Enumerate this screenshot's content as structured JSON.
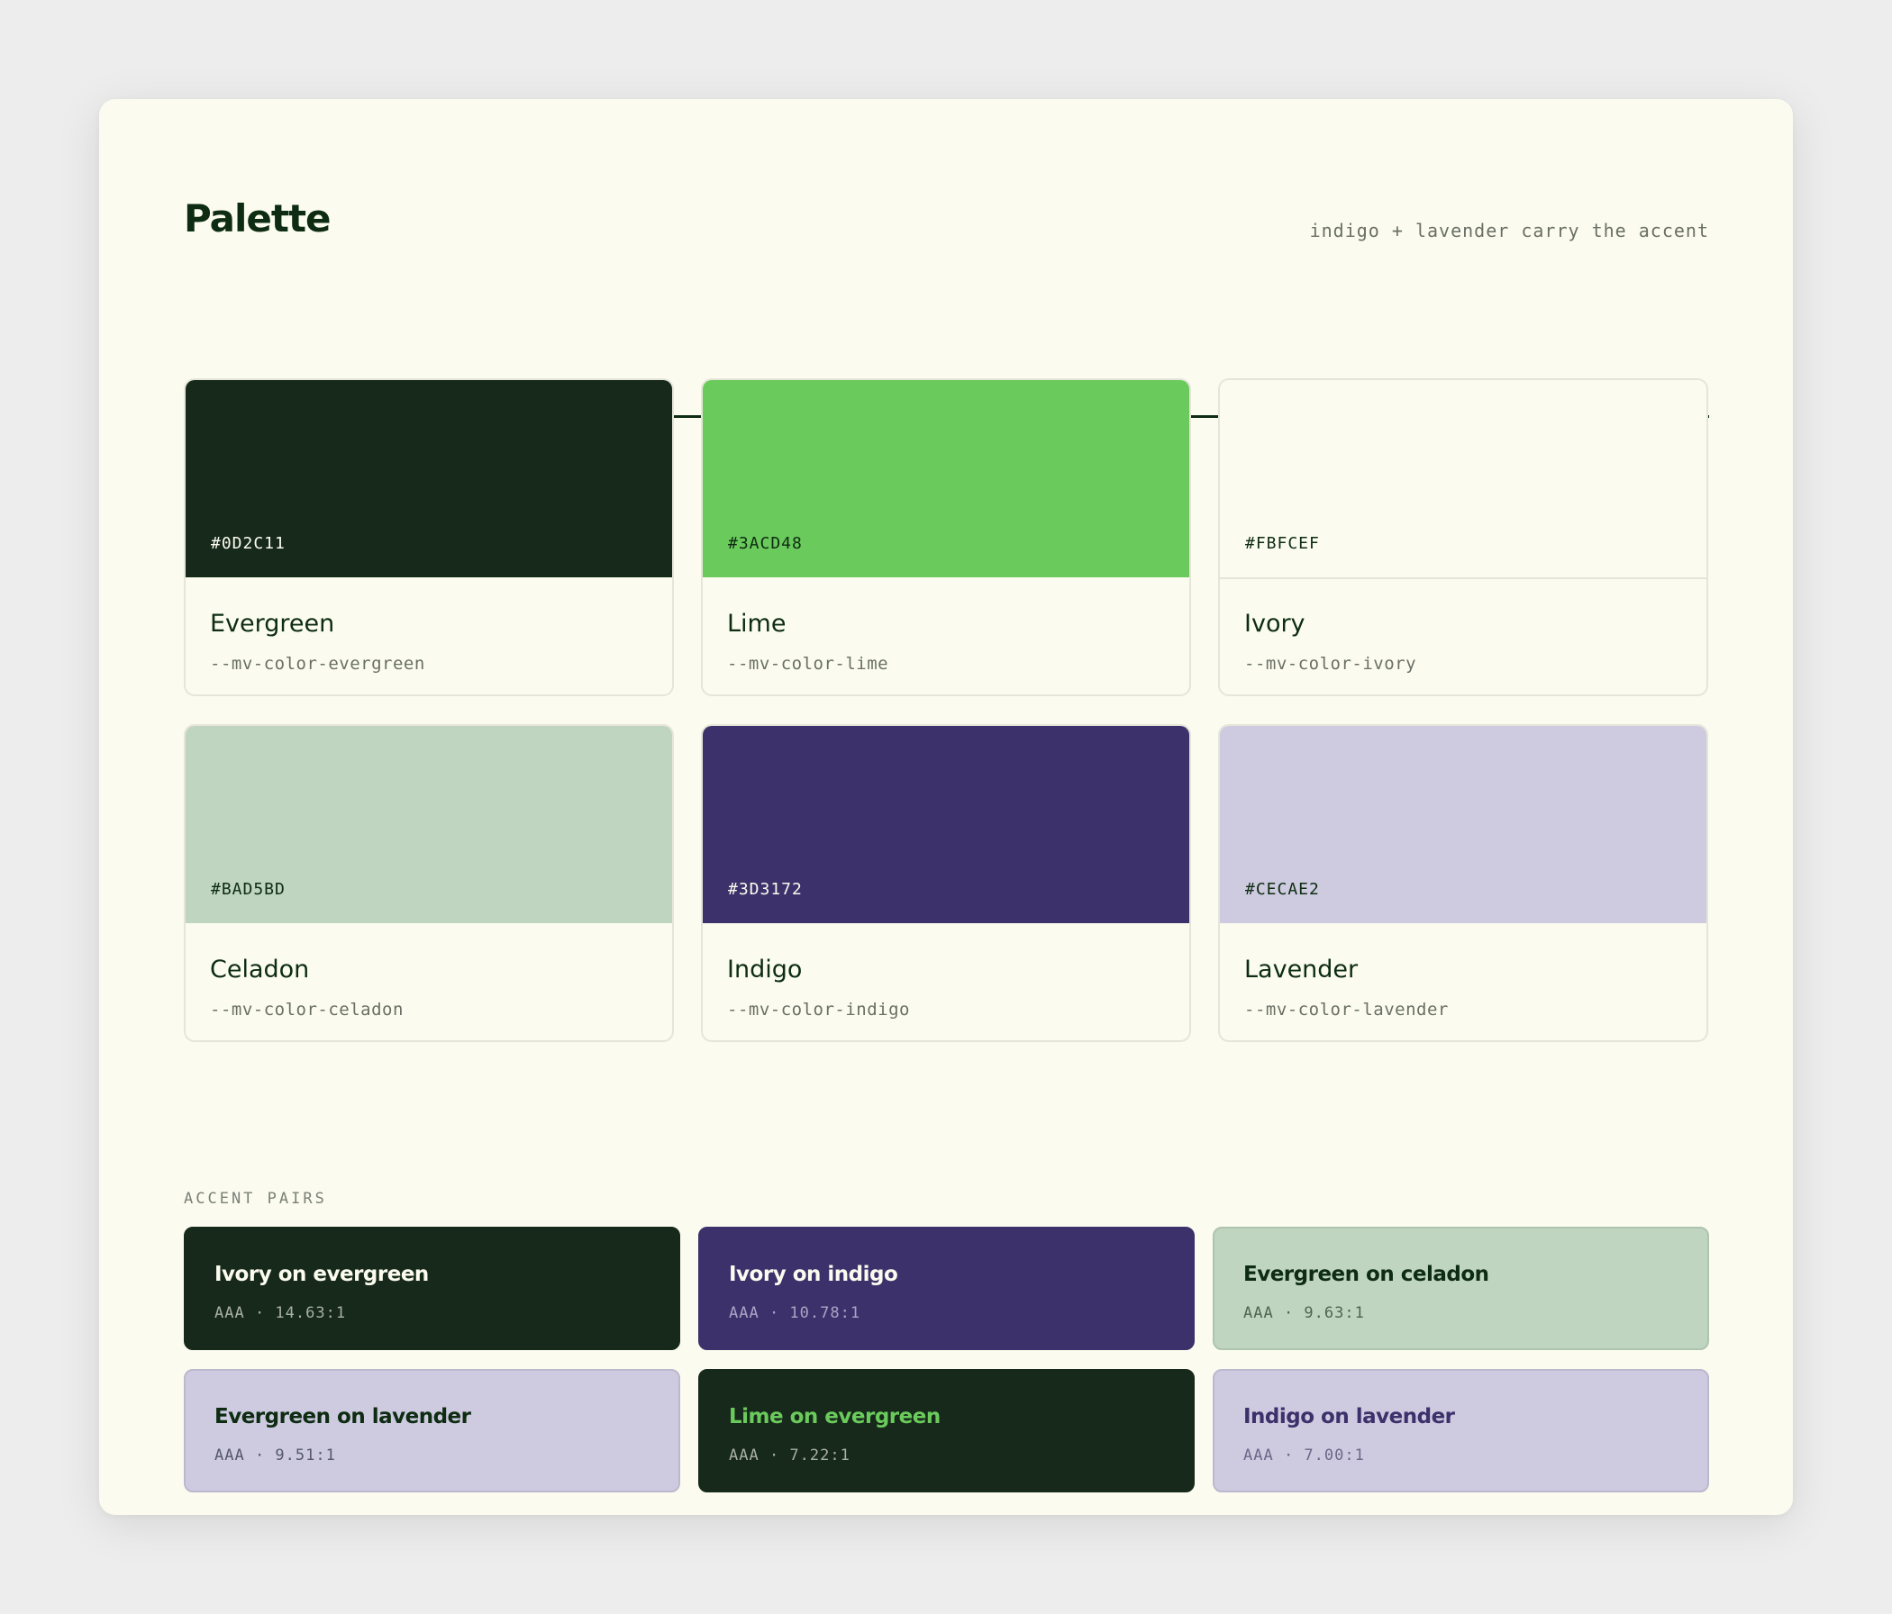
{
  "header": {
    "title": "Palette",
    "subtitle": "indigo + lavender carry the accent"
  },
  "swatches": [
    {
      "name": "Evergreen",
      "hex": "#0D2C11",
      "var": "--mv-color-evergreen",
      "color": "#16291a",
      "hex_color": "#fbfcef"
    },
    {
      "name": "Lime",
      "hex": "#3ACD48",
      "var": "--mv-color-lime",
      "color": "#6bca5c",
      "hex_color": "#0d2c11"
    },
    {
      "name": "Ivory",
      "hex": "#FBFCEF",
      "var": "--mv-color-ivory",
      "color": "#fbfcef",
      "hex_color": "#0d2c11"
    },
    {
      "name": "Celadon",
      "hex": "#BAD5BD",
      "var": "--mv-color-celadon",
      "color": "#bfd5bf",
      "hex_color": "#0d2c11"
    },
    {
      "name": "Indigo",
      "hex": "#3D3172",
      "var": "--mv-color-indigo",
      "color": "#3d316b",
      "hex_color": "#fbfcef"
    },
    {
      "name": "Lavender",
      "hex": "#CECAE2",
      "var": "--mv-color-lavender",
      "color": "#cecae0",
      "hex_color": "#0d2c11"
    }
  ],
  "accent_pairs": {
    "label": "ACCENT PAIRS",
    "items": [
      {
        "title": "Ivory on evergreen",
        "rating": "AAA · 14.63:1",
        "bg": "#16291a",
        "fg": "#fbfcef",
        "muted": "#a9b0a6",
        "border": "#16291a"
      },
      {
        "title": "Ivory on indigo",
        "rating": "AAA · 10.78:1",
        "bg": "#3d316b",
        "fg": "#fbfcef",
        "muted": "#aaa5c6",
        "border": "#3d316b"
      },
      {
        "title": "Evergreen on celadon",
        "rating": "AAA · 9.63:1",
        "bg": "#bfd5bf",
        "fg": "#0d2c11",
        "muted": "#4f6552",
        "border": "#aec4ae"
      },
      {
        "title": "Evergreen on lavender",
        "rating": "AAA · 9.51:1",
        "bg": "#cecae0",
        "fg": "#0d2c11",
        "muted": "#55586a",
        "border": "#bcb8cf"
      },
      {
        "title": "Lime on evergreen",
        "rating": "AAA · 7.22:1",
        "bg": "#16291a",
        "fg": "#6bca5c",
        "muted": "#a9b0a6",
        "border": "#16291a"
      },
      {
        "title": "Indigo on lavender",
        "rating": "AAA · 7.00:1",
        "bg": "#cecae0",
        "fg": "#3d316b",
        "muted": "#6c6788",
        "border": "#bcb8cf"
      }
    ]
  }
}
